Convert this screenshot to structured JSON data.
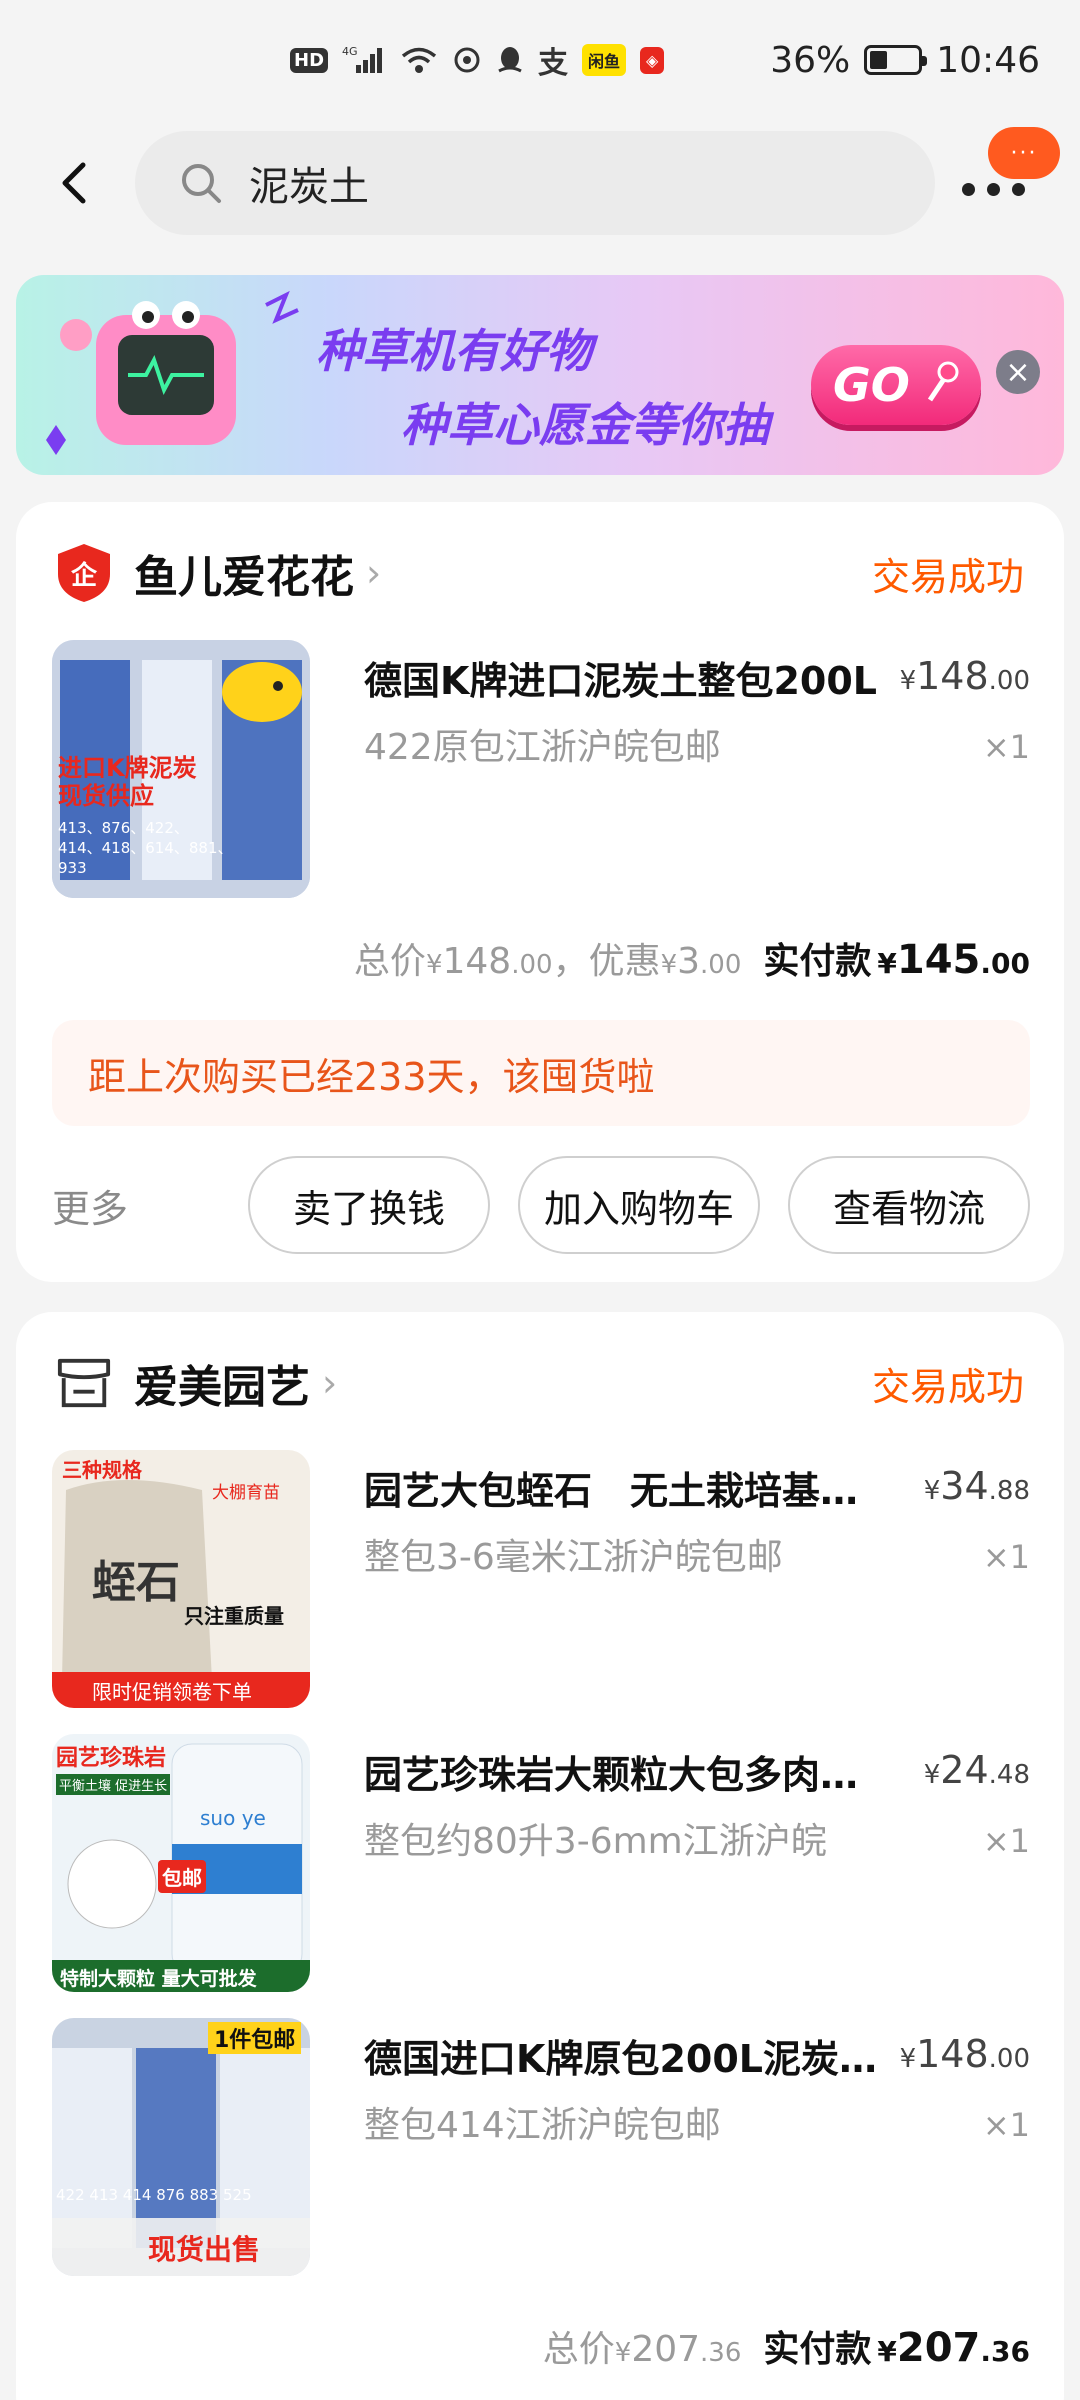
{
  "status_bar": {
    "hd": "HD",
    "network": "4G",
    "battery_text": "36%",
    "battery_level": 0.36,
    "time": "10:46"
  },
  "header": {
    "search_value": "泥炭土",
    "notification_badge": "···"
  },
  "banner": {
    "line1": "种草机有好物",
    "line2": "种草心愿金等你抽",
    "go_label": "GO"
  },
  "orders": [
    {
      "shop_name": "鱼儿爱花花",
      "status": "交易成功",
      "items": [
        {
          "title": "德国K牌进口泥炭土整包200L",
          "subtitle": "422原包江浙沪皖包邮",
          "price_int": "148",
          "price_dec": ".00",
          "qty": "×1",
          "thumb_text_1": "进口K牌泥炭",
          "thumb_text_2": "现货供应",
          "thumb_text_3": "413、876、422、",
          "thumb_text_4": "414、418、614、881、",
          "thumb_text_5": "933"
        }
      ],
      "total_label": "总价",
      "total_int": "148",
      "total_dec": ".00",
      "discount_label": "，优惠",
      "discount_int": "3",
      "discount_dec": ".00",
      "paid_label": "实付款",
      "paid_int": "145",
      "paid_dec": ".00",
      "reminder": "距上次购买已经233天，该囤货啦",
      "more_label": "更多",
      "buttons": [
        "卖了换钱",
        "加入购物车",
        "查看物流"
      ]
    },
    {
      "shop_name": "爱美园艺",
      "status": "交易成功",
      "items": [
        {
          "title": "园艺大包蛭石　无土栽培基质…",
          "subtitle": "整包3-6毫米江浙沪皖包邮",
          "price_int": "34",
          "price_dec": ".88",
          "qty": "×1",
          "thumb_text_1": "三种规格",
          "thumb_text_2": "蛭石",
          "thumb_text_3": "只注重质量",
          "thumb_text_4": "限时促销领卷下单",
          "thumb_text_5": "大棚育苗"
        },
        {
          "title": "园艺珍珠岩大颗粒大包多肉…",
          "subtitle": "整包约80升3-6mm江浙沪皖",
          "price_int": "24",
          "price_dec": ".48",
          "qty": "×1",
          "thumb_text_1": "园艺珍珠岩",
          "thumb_text_2": "平衡土壤 促进生长",
          "thumb_text_3": "包邮",
          "thumb_text_4": "特制大颗粒 量大可批发",
          "thumb_text_5": "suo ye"
        },
        {
          "title": "德国进口K牌原包200L泥炭…",
          "subtitle": "整包414江浙沪皖包邮",
          "price_int": "148",
          "price_dec": ".00",
          "qty": "×1",
          "thumb_text_1": "1件包邮",
          "thumb_text_2": "422 413 414 876 883 525",
          "thumb_text_3": "现货出售",
          "thumb_text_4": "",
          "thumb_text_5": ""
        }
      ],
      "total_label": "总价",
      "total_int": "207",
      "total_dec": ".36",
      "paid_label": "实付款",
      "paid_int": "207",
      "paid_dec": ".36"
    }
  ],
  "currency": "¥",
  "colors": {
    "accent": "#ff5a00",
    "reminder_text": "#e8551a",
    "reminder_bg": "#fff6f3",
    "shop_badge_red": "#e8281e"
  }
}
